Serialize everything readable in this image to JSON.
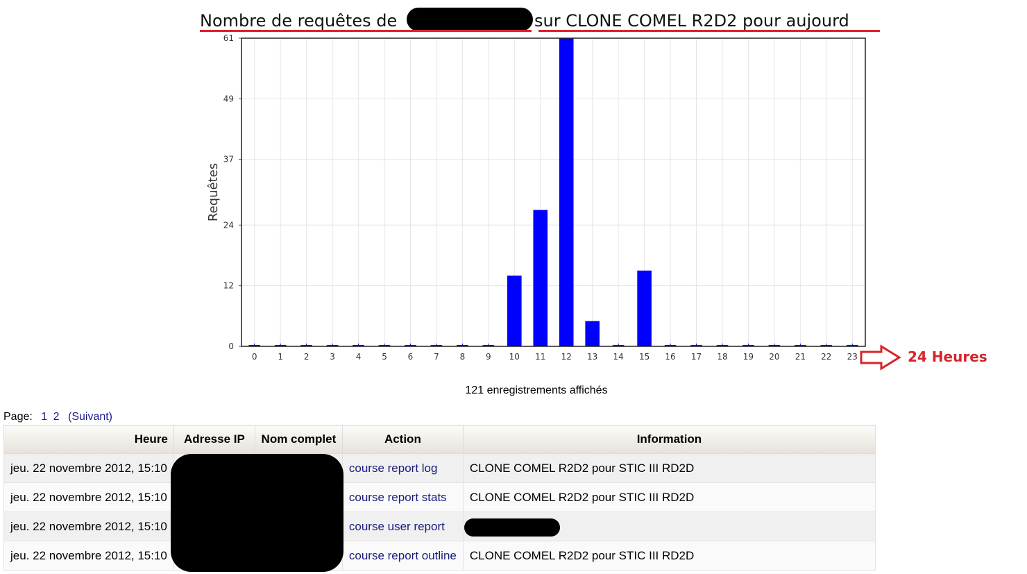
{
  "title": {
    "part1": "Nombre de requêtes de",
    "part2": "sur CLONE COMEL R2D2 pour aujourd"
  },
  "annotation": {
    "label": "24 Heures",
    "color": "#d8232a"
  },
  "chart_data": {
    "type": "bar",
    "ylabel": "Requêtes",
    "xlabel": "",
    "categories": [
      "0",
      "1",
      "2",
      "3",
      "4",
      "5",
      "6",
      "7",
      "8",
      "9",
      "10",
      "11",
      "12",
      "13",
      "14",
      "15",
      "16",
      "17",
      "18",
      "19",
      "20",
      "21",
      "22",
      "23"
    ],
    "values": [
      0,
      0,
      0,
      0,
      0,
      0,
      0,
      0,
      0,
      0,
      14,
      27,
      61,
      5,
      0,
      15,
      0,
      0,
      0,
      0,
      0,
      0,
      0,
      0
    ],
    "yticks": [
      0,
      12,
      24,
      37,
      49,
      61
    ],
    "ylim": [
      0,
      61
    ],
    "grid": true,
    "bar_color": "#0000ff"
  },
  "records_text": "121 enregistrements affichés",
  "pager": {
    "label": "Page:",
    "pages": [
      "1",
      "2"
    ],
    "next": "(Suivant)"
  },
  "table": {
    "headers": [
      "Heure",
      "Adresse IP",
      "Nom complet",
      "Action",
      "Information"
    ],
    "rows": [
      {
        "heure": "jeu. 22 novembre 2012, 15:10",
        "action": "course report log",
        "info": "CLONE COMEL R2D2 pour STIC III RD2D"
      },
      {
        "heure": "jeu. 22 novembre 2012, 15:10",
        "action": "course report stats",
        "info": "CLONE COMEL R2D2 pour STIC III RD2D"
      },
      {
        "heure": "jeu. 22 novembre 2012, 15:10",
        "action": "course user report",
        "info": ""
      },
      {
        "heure": "jeu. 22 novembre 2012, 15:10",
        "action": "course report outline",
        "info": "CLONE COMEL R2D2 pour STIC III RD2D"
      }
    ]
  }
}
